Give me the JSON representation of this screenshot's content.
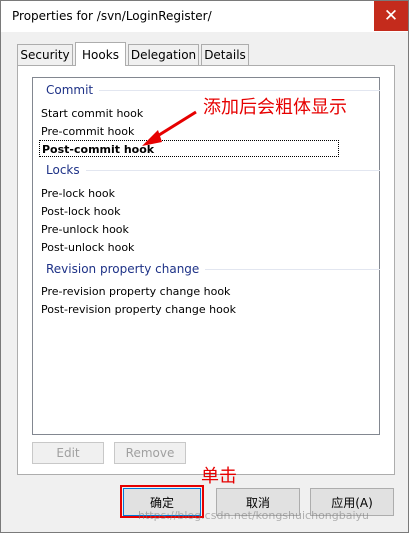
{
  "window": {
    "title": "Properties for /svn/LoginRegister/",
    "close_glyph": "✕"
  },
  "tabs": [
    {
      "label": "Security",
      "active": false
    },
    {
      "label": "Hooks",
      "active": true
    },
    {
      "label": "Delegation",
      "active": false
    },
    {
      "label": "Details",
      "active": false
    }
  ],
  "groups": {
    "commit": "Commit",
    "locks": "Locks",
    "revprop": "Revision property change"
  },
  "hooks": {
    "start_commit": "Start commit hook",
    "pre_commit": "Pre-commit hook",
    "post_commit": "Post-commit hook",
    "pre_lock": "Pre-lock hook",
    "post_lock": "Post-lock hook",
    "pre_unlock": "Pre-unlock hook",
    "post_unlock": "Post-unlock hook",
    "pre_revprop": "Pre-revision property change hook",
    "post_revprop": "Post-revision property change hook"
  },
  "panel_buttons": {
    "edit": "Edit",
    "remove": "Remove"
  },
  "dialog_buttons": {
    "ok": "确定",
    "cancel": "取消",
    "apply": "应用(A)"
  },
  "annotations": {
    "bold_note": "添加后会粗体显示",
    "click_note": "单击",
    "color": "#e60000"
  },
  "watermark": "https://blog.csdn.net/kongshuichongbaiyu"
}
